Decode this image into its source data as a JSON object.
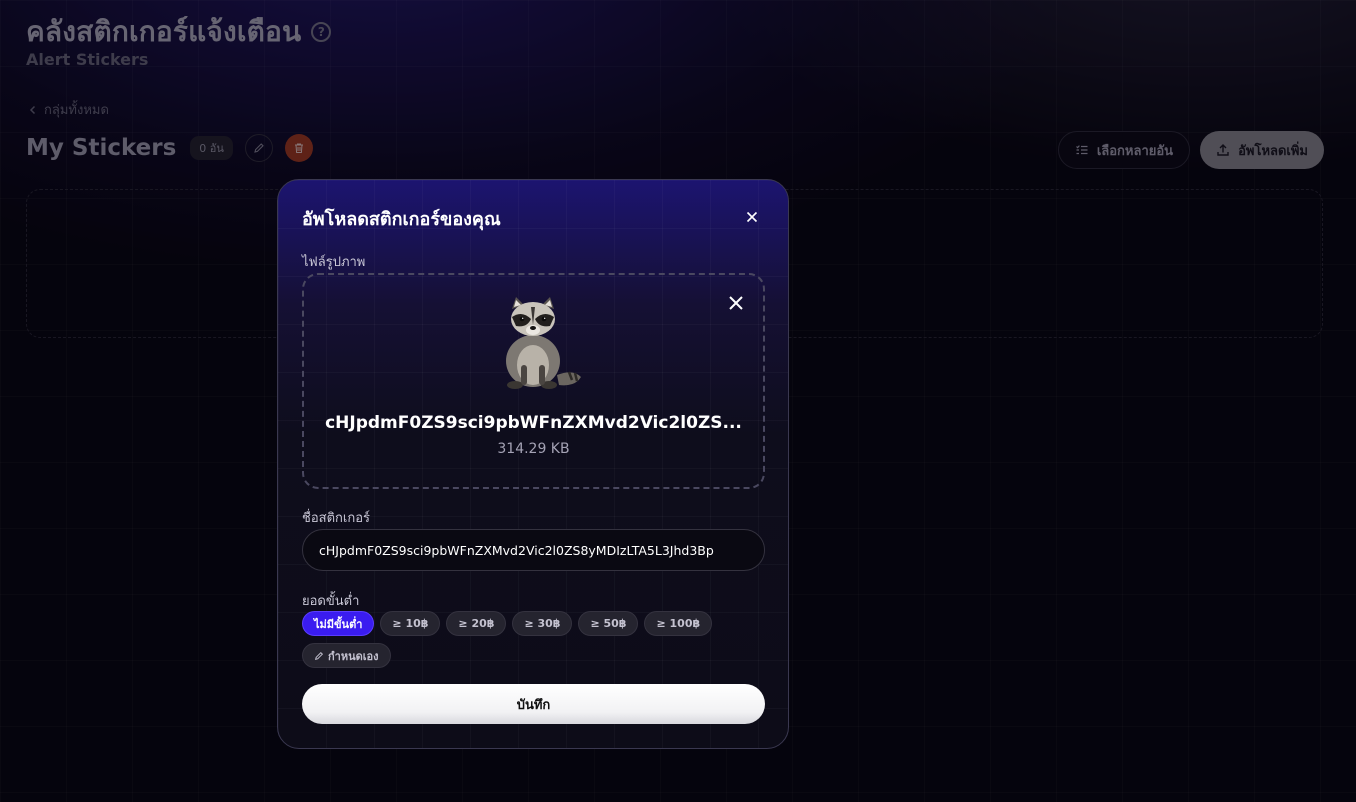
{
  "header": {
    "title": "คลังสติกเกอร์แจ้งเตือน",
    "subtitle": "Alert Stickers"
  },
  "breadcrumb": {
    "back_label": "กลุ่มทั้งหมด"
  },
  "group": {
    "name": "My Stickers",
    "count_badge": "0 อัน"
  },
  "actions": {
    "multi_select_label": "เลือกหลายอัน",
    "upload_more_label": "อัพโหลดเพิ่ม"
  },
  "modal": {
    "title": "อัพโหลดสติกเกอร์ของคุณ",
    "file_label": "ไฟล์รูปภาพ",
    "file": {
      "name": "cHJpdmF0ZS9sci9pbWFnZXMvd2Vic2l0ZS...",
      "size": "314.29 KB"
    },
    "sticker_name_label": "ชื่อสติกเกอร์",
    "sticker_name_value": "cHJpdmF0ZS9sci9pbWFnZXMvd2Vic2l0ZS8yMDIzLTA5L3Jhd3Bp",
    "min_amount_label": "ยอดขั้นต่ำ",
    "min_amount_options": [
      "ไม่มีขั้นต่ำ",
      "≥ 10฿",
      "≥ 20฿",
      "≥ 30฿",
      "≥ 50฿",
      "≥ 100฿"
    ],
    "min_amount_selected": "ไม่มีขั้นต่ำ",
    "custom_label": "กำหนดเอง",
    "save_label": "บันทึก"
  },
  "colors": {
    "accent": "#3a1cf0",
    "delete": "#a83c22",
    "modal_top": "#1c1470"
  }
}
